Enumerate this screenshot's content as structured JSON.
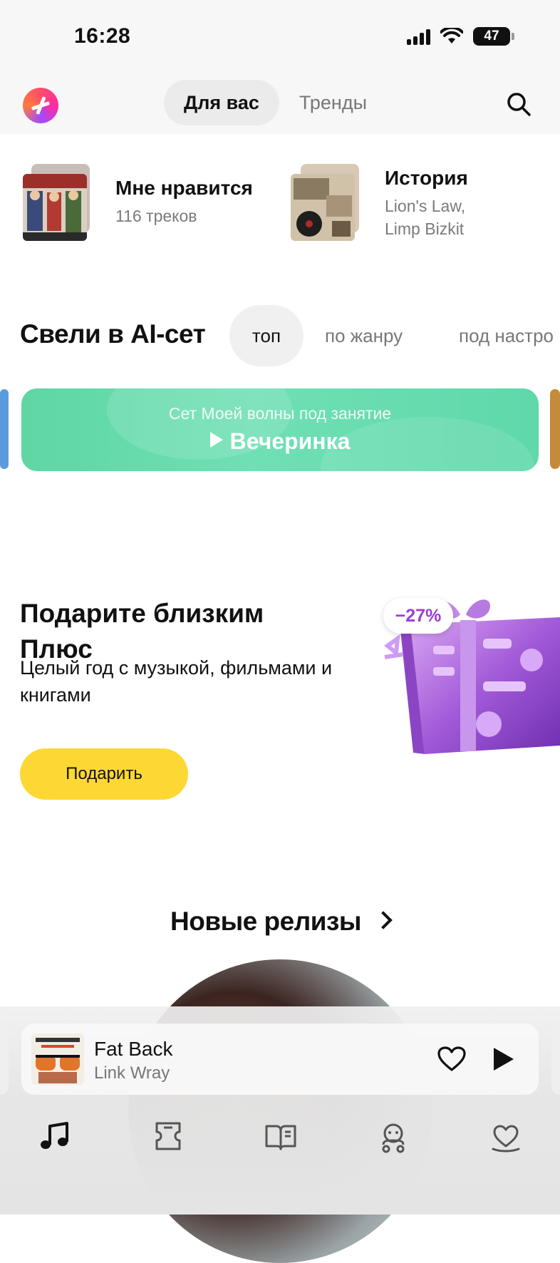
{
  "status_bar": {
    "time": "16:28",
    "battery": "47"
  },
  "header": {
    "tabs": [
      {
        "label": "Для вас",
        "active": true
      },
      {
        "label": "Тренды",
        "active": false
      }
    ]
  },
  "collections": [
    {
      "title": "Мне нравится",
      "subtitle": "116 треков"
    },
    {
      "title": "История",
      "subtitle_line1": "Lion's Law,",
      "subtitle_line2": "Limp Bizkit"
    }
  ],
  "ai_set": {
    "heading": "Свели в AI-сет",
    "chips": [
      "топ",
      "по жанру",
      "под настро"
    ],
    "banner": {
      "subtitle": "Сет Моей волны под занятие",
      "title": "Вечеринка"
    }
  },
  "promo": {
    "title": "Подарите близким Плюс",
    "text": "Целый год с музыкой, фильмами и книгами",
    "button": "Подарить",
    "discount": "−27%"
  },
  "new_releases": {
    "heading": "Новые релизы"
  },
  "player": {
    "title": "Fat Back",
    "artist": "Link Wray"
  },
  "colors": {
    "accent_yellow": "#fdd835",
    "banner_green": "#6fe0b4",
    "discount_purple": "#9b3dd6"
  },
  "tabbar": {
    "items": [
      {
        "icon": "music-note-icon",
        "active": true
      },
      {
        "icon": "ticket-icon"
      },
      {
        "icon": "book-icon"
      },
      {
        "icon": "kids-icon"
      },
      {
        "icon": "heart-collection-icon"
      }
    ]
  }
}
